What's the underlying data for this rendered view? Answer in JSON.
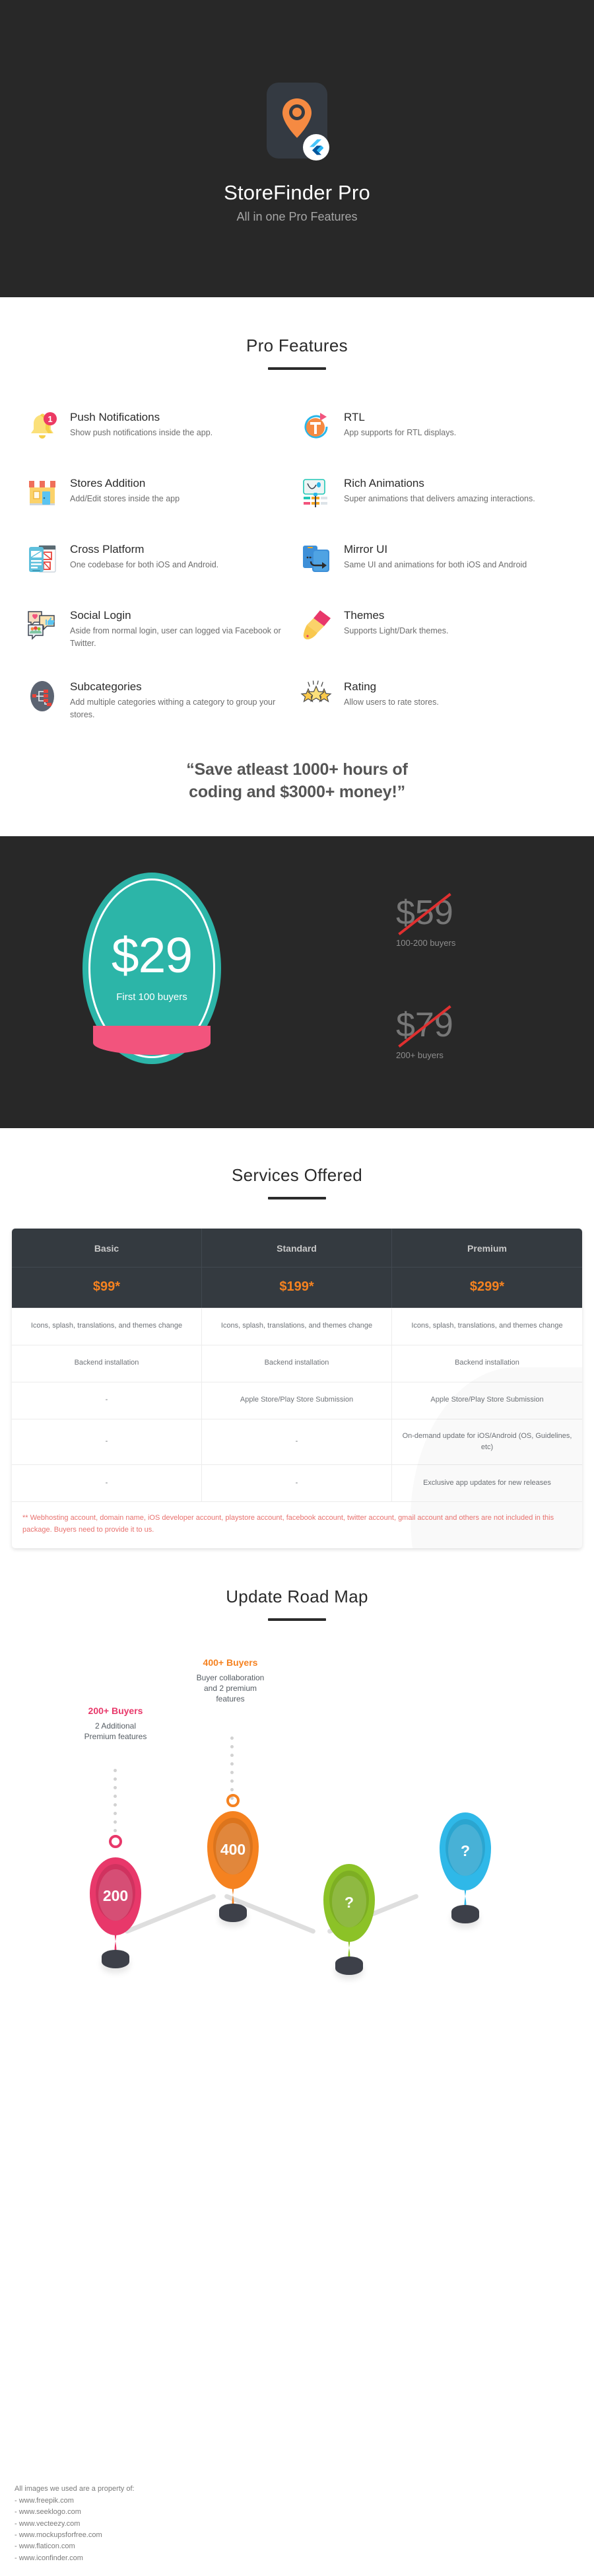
{
  "hero": {
    "icon_name": "map-pin-app-icon",
    "badge_name": "flutter-logo-badge",
    "title": "StoreFinder Pro",
    "subtitle": "All in one Pro Features"
  },
  "features_section": {
    "heading": "Pro Features",
    "items": [
      {
        "icon": "bell-notification-icon",
        "title": "Push Notifications",
        "desc": "Show push notifications inside the app."
      },
      {
        "icon": "rtl-rotate-icon",
        "title": "RTL",
        "desc": "App supports for RTL displays."
      },
      {
        "icon": "storefront-icon",
        "title": "Stores Addition",
        "desc": "Add/Edit stores inside the app"
      },
      {
        "icon": "animation-curve-icon",
        "title": "Rich Animations",
        "desc": "Super animations that delivers amazing interactions."
      },
      {
        "icon": "cross-platform-devices-icon",
        "title": "Cross Platform",
        "desc": "One codebase for both iOS and Android."
      },
      {
        "icon": "mirror-phones-icon",
        "title": "Mirror UI",
        "desc": "Same UI and animations for both iOS and Android"
      },
      {
        "icon": "social-chat-icon",
        "title": "Social Login",
        "desc": "Aside from normal login, user can logged via Facebook or Twitter."
      },
      {
        "icon": "paint-brush-icon",
        "title": "Themes",
        "desc": "Supports Light/Dark themes."
      },
      {
        "icon": "subcategory-tree-icon",
        "title": "Subcategories",
        "desc": "Add multiple categories withing a category to group your stores."
      },
      {
        "icon": "stars-rating-icon",
        "title": "Rating",
        "desc": "Allow users to rate stores."
      }
    ]
  },
  "quote": {
    "line1": "“Save atleast 1000+ hours of",
    "line2": "coding and $3000+ money!”"
  },
  "pricing": {
    "current_price": "$29",
    "current_caption": "First 100 buyers",
    "tiers": [
      {
        "price": "$59",
        "label": "100-200 buyers"
      },
      {
        "price": "$79",
        "label": "200+ buyers"
      }
    ],
    "colors": {
      "circle": "#2cb5a8",
      "ribbon": "#f2547d",
      "strike": "#e03030"
    }
  },
  "services": {
    "heading": "Services Offered",
    "columns": [
      "Basic",
      "Standard",
      "Premium"
    ],
    "prices": [
      "$99*",
      "$199*",
      "$299*"
    ],
    "rows": [
      [
        "Icons, splash, translations, and themes change",
        "Icons, splash, translations, and themes change",
        "Icons, splash, translations, and themes change"
      ],
      [
        "Backend installation",
        "Backend installation",
        "Backend installation"
      ],
      [
        "-",
        "Apple Store/Play Store Submission",
        "Apple Store/Play Store Submission"
      ],
      [
        "-",
        "-",
        "On-demand update for iOS/Android (OS, Guidelines, etc)"
      ],
      [
        "-",
        "-",
        "Exclusive app updates for new releases"
      ]
    ],
    "footnote": "** Webhosting account, domain name, iOS developer account, playstore account, facebook account, twitter account, gmail account and others are not included in this package. Buyers need to provide it to us."
  },
  "roadmap": {
    "heading": "Update Road Map",
    "milestones": [
      {
        "header": "200+ Buyers",
        "header_color": "#e8386a",
        "body": "2 Additional\nPremium features",
        "balloon_label": "200",
        "balloon_color": "#e8386a"
      },
      {
        "header": "400+ Buyers",
        "header_color": "#f58220",
        "body": "Buyer collaboration\nand 2 premium\nfeatures",
        "balloon_label": "400",
        "balloon_color": "#f58220"
      },
      {
        "header": "",
        "header_color": "#8cc227",
        "body": "",
        "balloon_label": "?",
        "balloon_color": "#8cc227"
      },
      {
        "header": "",
        "header_color": "#2fb8e8",
        "body": "",
        "balloon_label": "?",
        "balloon_color": "#2fb8e8"
      }
    ]
  },
  "footer": {
    "intro": "All images we used are a property of:",
    "links": [
      "- www.freepik.com",
      "- www.seeklogo.com",
      "- www.vecteezy.com",
      "- www.mockupsforfree.com",
      "- www.flaticon.com",
      "- www.iconfinder.com"
    ]
  }
}
